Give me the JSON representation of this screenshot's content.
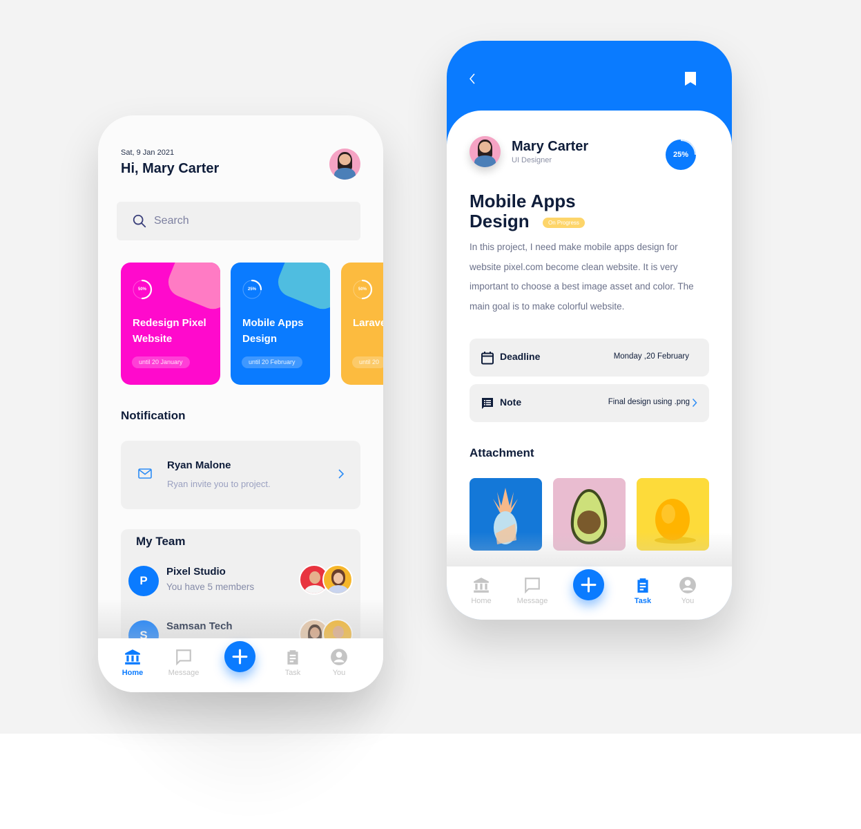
{
  "colors": {
    "primary": "#0a7bff",
    "pink": "#ff0acc",
    "orange": "#fcbb3f",
    "status_yellow": "#fdd56a",
    "text_dark": "#0f1d3a",
    "background": "#f3f3f3"
  },
  "home": {
    "date": "Sat, 9 Jan 2021",
    "greeting": "Hi, Mary Carter",
    "search": {
      "placeholder": "Search",
      "icon": "search-icon"
    },
    "projects": [
      {
        "progress_label": "50%",
        "progress": 0.5,
        "title": "Redesign Pixel Website",
        "due": "until 20 January",
        "color": "#ff0acc"
      },
      {
        "progress_label": "25%",
        "progress": 0.25,
        "title": "Mobile Apps Design",
        "due": "until 20 February",
        "color": "#0a7bff"
      },
      {
        "progress_label": "50%",
        "progress": 0.5,
        "title": "Laravel Project",
        "due": "until 20",
        "color": "#fcbb3f"
      }
    ],
    "notification": {
      "section_title": "Notification",
      "item": {
        "name": "Ryan Malone",
        "message": "Ryan invite you to project."
      }
    },
    "team": {
      "section_title": "My Team",
      "rows": [
        {
          "letter": "P",
          "name": "Pixel Studio",
          "subtitle": "You have 5 members"
        },
        {
          "letter": "S",
          "name": "Samsan Tech",
          "subtitle": ""
        }
      ]
    }
  },
  "task": {
    "owner": {
      "name": "Mary Carter",
      "role": "UI Designer"
    },
    "progress_label": "25%",
    "progress": 0.25,
    "title": "Mobile Apps Design",
    "status": "On Progress",
    "description": "In this project, I need make mobile apps design for website pixel.com become clean website. It is very important to choose a best image asset and color. The main goal is to make colorful website.",
    "deadline": {
      "label": "Deadline",
      "value": "Monday ,20 February"
    },
    "note": {
      "label": "Note",
      "value": "Final design using .png"
    },
    "attachment_title": "Attachment",
    "attachments": [
      "pineapple-image",
      "avocado-image",
      "lemon-image"
    ]
  },
  "tabbar": {
    "home": "Home",
    "message": "Message",
    "task": "Task",
    "you": "You"
  }
}
